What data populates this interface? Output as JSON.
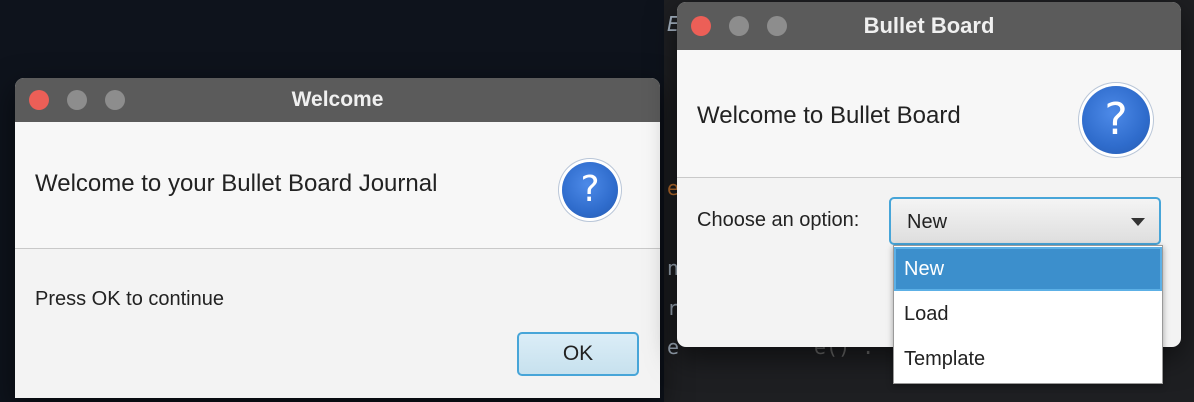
{
  "editor": {
    "fragments": [
      "E",
      "e",
      "n",
      "r",
      "e",
      "e() ."
    ]
  },
  "welcome_dialog": {
    "title": "Welcome",
    "header_text": "Welcome to your Bullet Board Journal",
    "body_text": "Press OK to continue",
    "ok_label": "OK",
    "icon_glyph": "?"
  },
  "bullet_dialog": {
    "title": "Bullet Board",
    "header_text": "Welcome to Bullet Board",
    "icon_glyph": "?",
    "choose_label": "Choose an option:",
    "selected_value": "New",
    "options": [
      {
        "label": "New",
        "selected": true
      },
      {
        "label": "Load",
        "selected": false
      },
      {
        "label": "Template",
        "selected": false
      }
    ]
  },
  "colors": {
    "accent": "#47a5d8",
    "selection": "#3c8fcc",
    "close_button": "#ec5f57",
    "titlebar": "#5b5b5b"
  },
  "icons": [
    "close-dot",
    "minimize-dot",
    "zoom-dot",
    "question-icon",
    "dropdown-arrow-icon"
  ]
}
